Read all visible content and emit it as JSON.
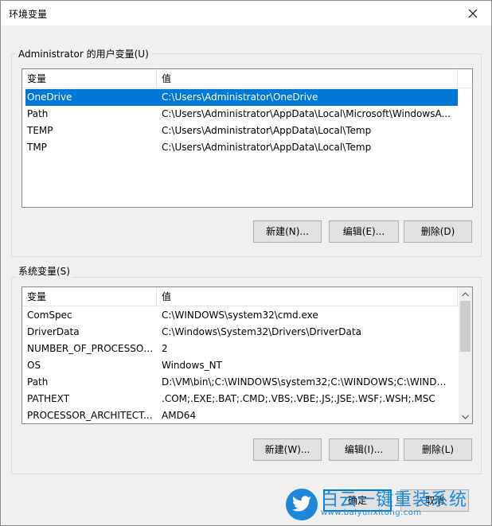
{
  "window": {
    "title": "环境变量"
  },
  "user_vars": {
    "group_label": "Administrator 的用户变量(U)",
    "columns": [
      "变量",
      "值"
    ],
    "rows": [
      {
        "name": "OneDrive",
        "value": "C:\\Users\\Administrator\\OneDrive",
        "selected": true
      },
      {
        "name": "Path",
        "value": "C:\\Users\\Administrator\\AppData\\Local\\Microsoft\\WindowsA..."
      },
      {
        "name": "TEMP",
        "value": "C:\\Users\\Administrator\\AppData\\Local\\Temp"
      },
      {
        "name": "TMP",
        "value": "C:\\Users\\Administrator\\AppData\\Local\\Temp"
      }
    ],
    "buttons": {
      "new": "新建(N)...",
      "edit": "编辑(E)...",
      "delete": "删除(D)"
    }
  },
  "system_vars": {
    "group_label": "系统变量(S)",
    "columns": [
      "变量",
      "值"
    ],
    "rows": [
      {
        "name": "ComSpec",
        "value": "C:\\WINDOWS\\system32\\cmd.exe"
      },
      {
        "name": "DriverData",
        "value": "C:\\Windows\\System32\\Drivers\\DriverData"
      },
      {
        "name": "NUMBER_OF_PROCESSORS",
        "value": "2"
      },
      {
        "name": "OS",
        "value": "Windows_NT"
      },
      {
        "name": "Path",
        "value": "D:\\VM\\bin\\;C:\\WINDOWS\\system32;C:\\WINDOWS;C:\\WINDO..."
      },
      {
        "name": "PATHEXT",
        "value": ".COM;.EXE;.BAT;.CMD;.VBS;.VBE;.JS;.JSE;.WSF;.WSH;.MSC"
      },
      {
        "name": "PROCESSOR_ARCHITECT...",
        "value": "AMD64"
      }
    ],
    "buttons": {
      "new": "新建(W)...",
      "edit": "编辑(I)...",
      "delete": "删除(L)"
    }
  },
  "footer": {
    "ok": "确定",
    "cancel": "取消"
  },
  "watermark": {
    "text": "白云一键重装系统",
    "url": "www.baiyunxitong.com"
  },
  "colors": {
    "selection": "#0078d7",
    "watermark": "#1e88d8"
  }
}
